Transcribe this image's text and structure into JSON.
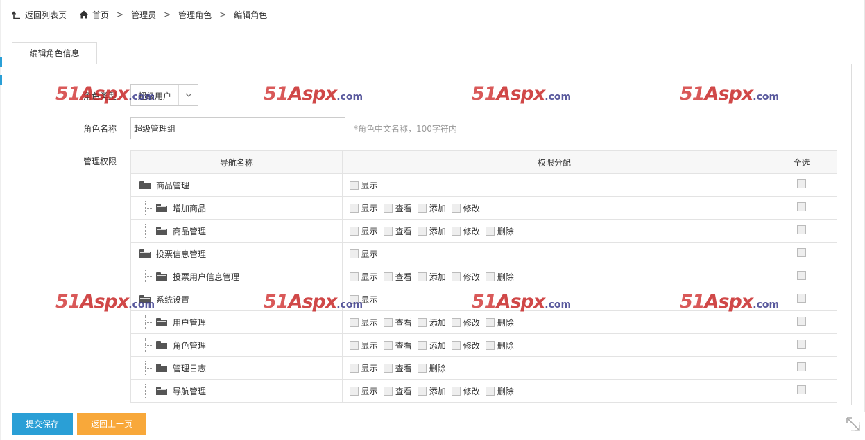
{
  "breadcrumb": {
    "back_label": "返回列表页",
    "items": [
      "首页",
      "管理员",
      "管理角色",
      "编辑角色"
    ]
  },
  "tab_label": "编辑角色信息",
  "form": {
    "type_label": "角色类型",
    "type_value": "超级用户",
    "name_label": "角色名称",
    "name_value": "超级管理组",
    "name_hint": "*角色中文名称，100字符内",
    "perm_label": "管理权限"
  },
  "table": {
    "headers": [
      "导航名称",
      "权限分配",
      "全选"
    ],
    "rows": [
      {
        "name": "商品管理",
        "level": 0,
        "perms": [
          "显示"
        ]
      },
      {
        "name": "增加商品",
        "level": 1,
        "perms": [
          "显示",
          "查看",
          "添加",
          "修改"
        ]
      },
      {
        "name": "商品管理",
        "level": 1,
        "perms": [
          "显示",
          "查看",
          "添加",
          "修改",
          "删除"
        ]
      },
      {
        "name": "投票信息管理",
        "level": 0,
        "perms": [
          "显示"
        ]
      },
      {
        "name": "投票用户信息管理",
        "level": 1,
        "perms": [
          "显示",
          "查看",
          "添加",
          "修改",
          "删除"
        ]
      },
      {
        "name": "系统设置",
        "level": 0,
        "perms": [
          "显示"
        ]
      },
      {
        "name": "用户管理",
        "level": 1,
        "perms": [
          "显示",
          "查看",
          "添加",
          "修改",
          "删除"
        ]
      },
      {
        "name": "角色管理",
        "level": 1,
        "perms": [
          "显示",
          "查看",
          "添加",
          "修改",
          "删除"
        ]
      },
      {
        "name": "管理日志",
        "level": 1,
        "perms": [
          "显示",
          "查看",
          "删除"
        ]
      },
      {
        "name": "导航管理",
        "level": 1,
        "perms": [
          "显示",
          "查看",
          "添加",
          "修改",
          "删除"
        ]
      }
    ]
  },
  "buttons": {
    "save": "提交保存",
    "back": "返回上一页"
  },
  "watermark": {
    "num": "51",
    "brand": "Aspx",
    "suffix": ".com"
  },
  "colors": {
    "primary": "#2a9fd6",
    "warning": "#f8a83a",
    "watermark": "#d23c3c"
  }
}
